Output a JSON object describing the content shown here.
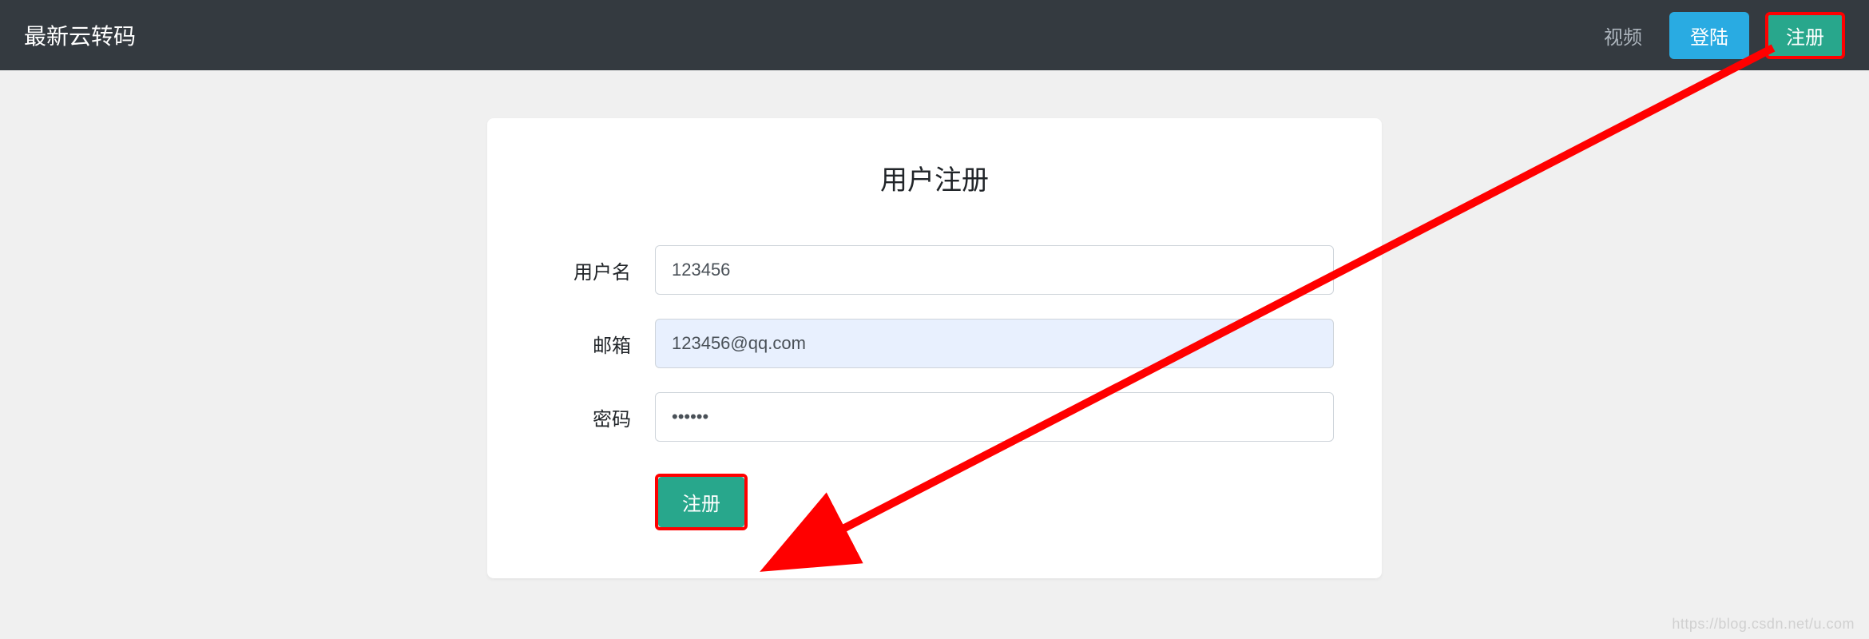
{
  "navbar": {
    "brand": "最新云转码",
    "video_link": "视频",
    "login_label": "登陆",
    "register_label": "注册"
  },
  "form": {
    "title": "用户注册",
    "username_label": "用户名",
    "username_value": "123456",
    "email_label": "邮箱",
    "email_value": "123456@qq.com",
    "password_label": "密码",
    "password_value": "••••••",
    "submit_label": "注册"
  },
  "watermark": "https://blog.csdn.net/u.com",
  "colors": {
    "navbar_bg": "#343a40",
    "primary": "#29abe2",
    "success": "#28a78c",
    "highlight": "#ff0000"
  }
}
